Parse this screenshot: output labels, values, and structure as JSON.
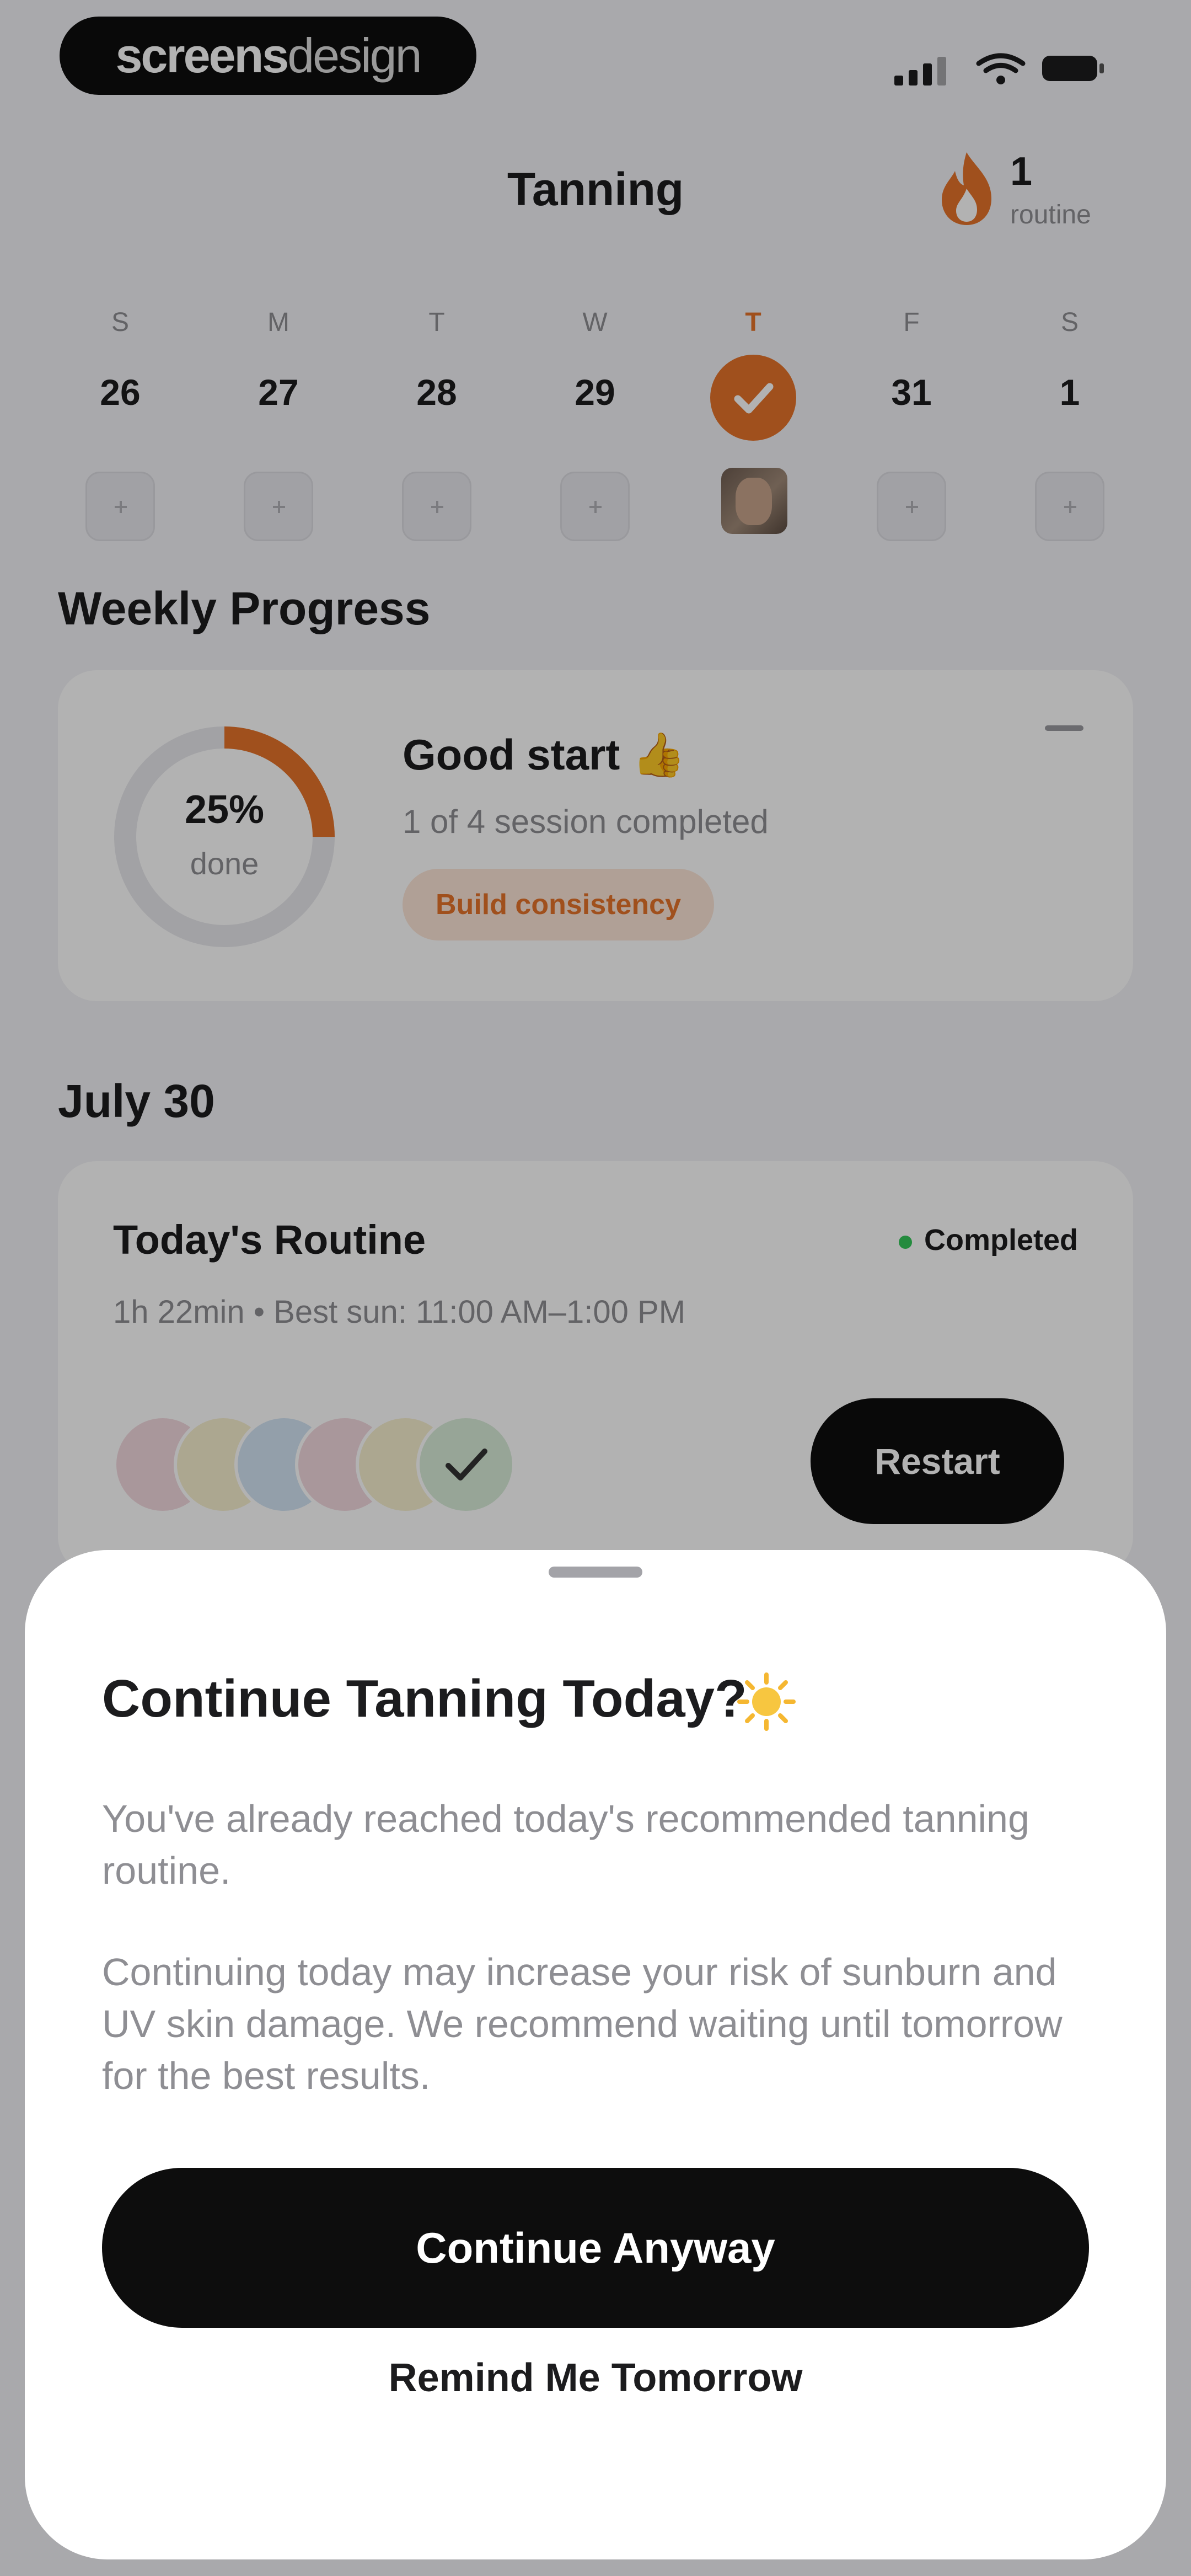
{
  "status_bar": {
    "logo_bold": "screens",
    "logo_light": "design"
  },
  "header": {
    "title": "Tanning",
    "streak_count": "1",
    "streak_label": "routine",
    "accent_color": "#e6732a"
  },
  "week": {
    "days": [
      {
        "letter": "S",
        "number": "26"
      },
      {
        "letter": "M",
        "number": "27"
      },
      {
        "letter": "T",
        "number": "28"
      },
      {
        "letter": "W",
        "number": "29"
      },
      {
        "letter": "T",
        "number": "30",
        "today": true,
        "completed": true
      },
      {
        "letter": "F",
        "number": "31"
      },
      {
        "letter": "S",
        "number": "1"
      }
    ]
  },
  "weekly_progress": {
    "section_title": "Weekly Progress",
    "percent_text": "25%",
    "percent_value": 0.25,
    "percent_label": "done",
    "title": "Good start 👍",
    "subtitle": "1 of 4 session completed",
    "badge": "Build consistency"
  },
  "day_section": {
    "date_title": "July 30",
    "routine_title": "Today's Routine",
    "status": "Completed",
    "status_color": "#34c759",
    "meta": "1h 22min  •  Best sun: 11:00 AM–1:00 PM",
    "restart_label": "Restart"
  },
  "sheet": {
    "title": "Continue Tanning Today?",
    "paragraph_1": "You've already reached today's recommended tanning routine.",
    "paragraph_2": "Continuing today may increase your risk of sunburn and UV skin damage. We recommend waiting until tomorrow for the best results.",
    "primary_button": "Continue Anyway",
    "secondary_button": "Remind Me Tomorrow"
  }
}
